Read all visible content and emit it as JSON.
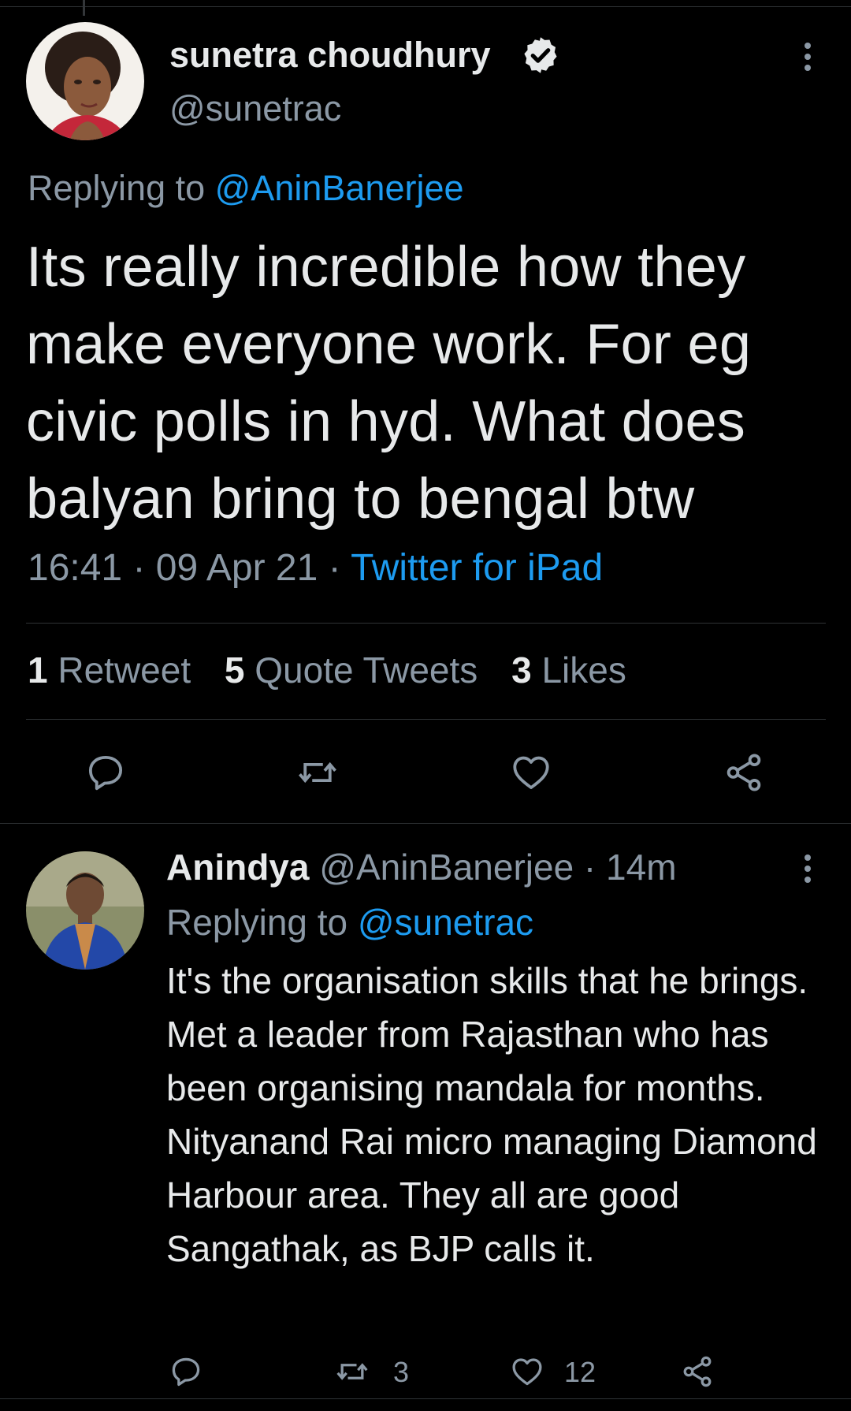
{
  "main_tweet": {
    "author_name": "sunetra choudhury",
    "handle": "@sunetrac",
    "replying_prefix": "Replying to ",
    "replying_to": "@AninBanerjee",
    "text": "Its really incredible how they make everyone work. For eg civic polls in hyd. What does balyan bring to bengal btw",
    "time": "16:41",
    "date": "09 Apr 21",
    "separator": " · ",
    "source": "Twitter for iPad",
    "stats": {
      "retweets_count": "1",
      "retweets_label": "Retweet",
      "quotes_count": "5",
      "quotes_label": "Quote Tweets",
      "likes_count": "3",
      "likes_label": "Likes"
    },
    "icons": [
      "verified-badge-icon",
      "more-vertical-icon",
      "reply-icon",
      "retweet-icon",
      "like-icon",
      "share-icon"
    ]
  },
  "reply_tweet": {
    "author_name": "Anindya",
    "handle": "@AninBanerjee",
    "separator": " · ",
    "time_ago": "14m",
    "replying_prefix": "Replying to ",
    "replying_to": "@sunetrac",
    "text": "It's the organisation skills that he brings. Met a leader from Rajasthan who has been organising mandala for months. Nityanand Rai micro managing Diamond Harbour area. They all are good Sangathak, as BJP calls it.",
    "retweet_count": "3",
    "like_count": "12",
    "icons": [
      "more-vertical-icon",
      "reply-icon",
      "retweet-icon",
      "like-icon",
      "share-icon"
    ]
  },
  "colors": {
    "background": "#000000",
    "text_primary": "#e7e9ea",
    "text_secondary": "#8b98a5",
    "link": "#1d9bf0",
    "divider": "#2f3336"
  }
}
